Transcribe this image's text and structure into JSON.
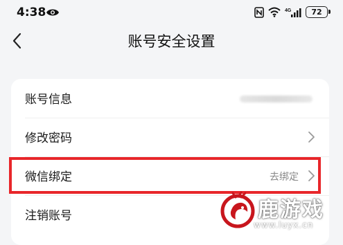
{
  "status_bar": {
    "time": "4:38",
    "battery": "72",
    "network": "4G"
  },
  "nav": {
    "title": "账号安全设置"
  },
  "settings": {
    "account_info": {
      "label": "账号信息"
    },
    "change_password": {
      "label": "修改密码"
    },
    "wechat_binding": {
      "label": "微信绑定",
      "value": "去绑定"
    },
    "cancel_account": {
      "label": "注销账号"
    }
  },
  "watermark": {
    "name": "鹿游戏",
    "url": "www.luyx.cn"
  },
  "colors": {
    "highlight": "#e8262a",
    "background": "#f4f5f7",
    "card": "#ffffff",
    "logo": "#c8161d"
  }
}
